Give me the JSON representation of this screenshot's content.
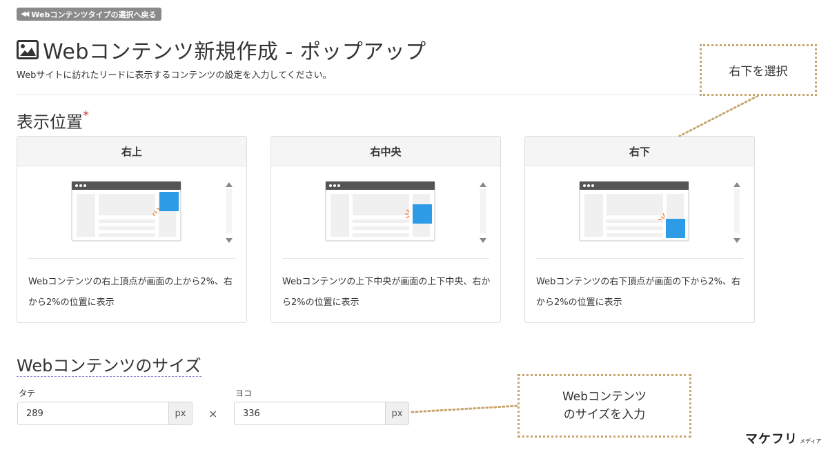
{
  "back_button": {
    "label": "Webコンテンツタイプの選択へ戻る"
  },
  "header": {
    "title": "Webコンテンツ新規作成 - ポップアップ",
    "subtitle": "Webサイトに訪れたリードに表示するコンテンツの設定を入力してください。"
  },
  "position": {
    "title": "表示位置",
    "required_mark": "*",
    "cards": [
      {
        "label": "右上",
        "placement": "top-right",
        "description": "Webコンテンツの右上頂点が画面の上から2%、右から2%の位置に表示"
      },
      {
        "label": "右中央",
        "placement": "middle-right",
        "description": "Webコンテンツの上下中央が画面の上下中央、右から2%の位置に表示"
      },
      {
        "label": "右下",
        "placement": "bottom-right",
        "description": "Webコンテンツの右下頂点が画面の下から2%、右から2%の位置に表示"
      }
    ]
  },
  "size": {
    "title": "Webコンテンツのサイズ",
    "height_label": "タテ",
    "height_value": "289",
    "width_label": "ヨコ",
    "width_value": "336",
    "unit": "px",
    "separator": "×"
  },
  "annotations": {
    "select_bottom_right": "右下を選択",
    "input_size_line1": "Webコンテンツ",
    "input_size_line2": "のサイズを入力"
  },
  "logo": {
    "main": "マケフリ",
    "sub": "メディア"
  },
  "colors": {
    "accent_blue": "#2d9be5",
    "annotation_border": "#c8a56e",
    "back_button_bg": "#8a8a8a"
  }
}
